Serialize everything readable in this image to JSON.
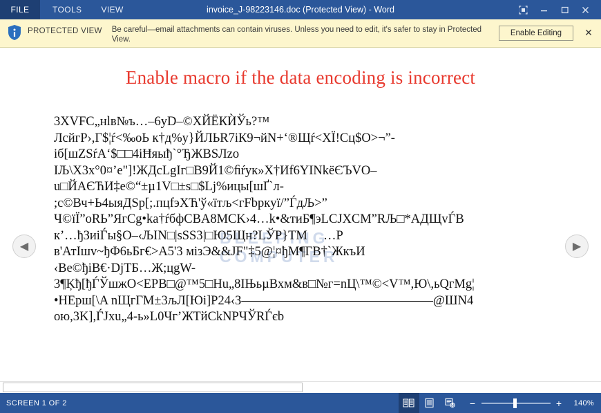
{
  "titlebar": {
    "file_tab": "FILE",
    "tabs": [
      {
        "label": "TOOLS"
      },
      {
        "label": "VIEW"
      }
    ],
    "document_title": "invoice_J-98223146.doc (Protected View) - Word",
    "window_buttons": {
      "ribbon_display": "ribbon-display-options-icon",
      "minimize": "minimize-icon",
      "restore": "restore-icon",
      "close": "close-icon"
    },
    "colors": {
      "bar": "#2b579a",
      "file_tab": "#1e3f73"
    }
  },
  "protected_view": {
    "icon": "info-shield-icon",
    "label": "PROTECTED VIEW",
    "message": "Be careful—email attachments can contain viruses. Unless you need to edit, it's safer to stay in Protected View.",
    "enable_button": "Enable Editing",
    "close": "✕",
    "colors": {
      "background": "#fdf6cd",
      "border": "#dcd7a8"
    }
  },
  "document": {
    "heading": "Enable macro if the data encoding is incorrect",
    "heading_color": "#e8392e",
    "body": "3XVFC„нlв№ъ…–6yD–©ХЙЁКЍЎь?™\nЛсйгР›,Г$¦ŕ<‰oЬ к†д%y}ЙЛЬR7iК9¬йN+‘®Щŕ<ХЇ!Сц$O>¬”-\nіб[шZSŕA‘$□□4iĦяыђ`°ЂЖВSЛzo\nIЉ\\X3x°0¤’e\"]!ЖДcLgIг□B9Й1©ﬁŕук»Х†Иf6ΥΙNkёЄЪVO–\nu□ЙАЄЋИ‡e©“±µ1V□±s□$Lj%ицы[шҐ`л-\n;c©Вч+Ь4ыяДSp[;.пцfэХЋ'ў«ïтљ<гFbpкyї/”ЃдЉ>”\nЧ©ïЇ”oRЬ”ЯгCg•ka†ŕбфCBA8MCK›4…k•&тиБ¶эLCJXCM”RЉ□*АДЩvЃВ\nк’…ђЗиiЃы§O–‹ЉIN□|sSS3|□Ю5Щн?LЎP}TM     …P\nв'АтIшv~ђФ6ьБг€>A5'3 мізЭ&&JF\"‡5@¦¤ђМ¶ГВ†`ЖкъИ\n‹Be©ђiB€·DjTБ…Ж;цgW-\n3¶Ķђ[ђЃЎшжO<EPB□@™5□Hu„8IЊьµВхм&в□№г=nЦ\\™©<V™,Ю\\,ьQгMg¦\n•НЕрш[\\A nЩгГМ±3љЛ[Юi]P24‹З———————————————@ШN4\nою,3K],ЃJxu„4-ь»L0Чг’ЖТйCkNPЧЎRЃєb",
    "watermark_line1": "BLEEPING",
    "watermark_line2": "COMPUTER",
    "nav_prev": "◀",
    "nav_next": "▶"
  },
  "statusbar": {
    "screen_indicator": "SCREEN 1 OF 2",
    "view_buttons": [
      {
        "name": "read-mode-icon",
        "active": true
      },
      {
        "name": "print-layout-icon",
        "active": false
      },
      {
        "name": "web-layout-icon",
        "active": false
      }
    ],
    "zoom_out": "−",
    "zoom_in": "+",
    "zoom_value": "140%",
    "colors": {
      "bar": "#2b579a"
    }
  }
}
